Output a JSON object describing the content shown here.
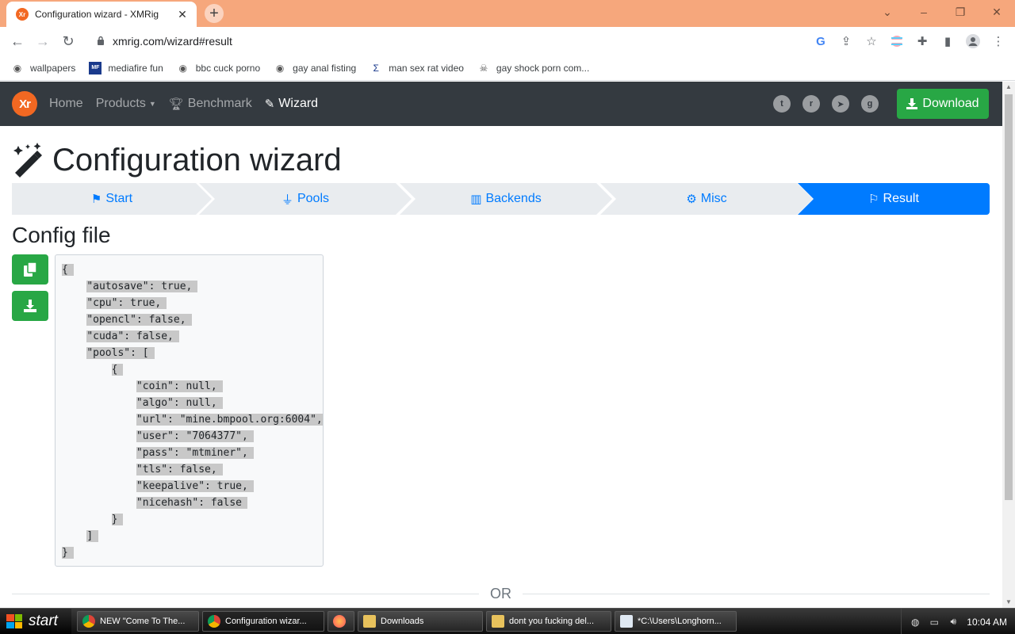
{
  "browser": {
    "tab_title": "Configuration wizard - XMRig",
    "favicon_text": "Xr",
    "url": "xmrig.com/wizard#result",
    "bookmarks": [
      {
        "label": "wallpapers"
      },
      {
        "label": "mediafire fun"
      },
      {
        "label": "bbc cuck porno"
      },
      {
        "label": "gay anal fisting"
      },
      {
        "label": "man sex rat video"
      },
      {
        "label": "gay shock porn com..."
      }
    ]
  },
  "navbar": {
    "brand": "Xr",
    "links": [
      "Home",
      "Products",
      "Benchmark",
      "Wizard"
    ],
    "download_label": "Download"
  },
  "page": {
    "title": "Configuration wizard",
    "steps": [
      "Start",
      "Pools",
      "Backends",
      "Misc",
      "Result"
    ],
    "active_step": "Result",
    "config_title": "Config file",
    "or_label": "OR"
  },
  "config_lines": [
    "{",
    "    \"autosave\": true,",
    "    \"cpu\": true,",
    "    \"opencl\": false,",
    "    \"cuda\": false,",
    "    \"pools\": [",
    "        {",
    "            \"coin\": null,",
    "            \"algo\": null,",
    "            \"url\": \"mine.bmpool.org:6004\",",
    "            \"user\": \"7064377\",",
    "            \"pass\": \"mtminer\",",
    "            \"tls\": false,",
    "            \"keepalive\": true,",
    "            \"nicehash\": false",
    "        }",
    "    ]",
    "}"
  ],
  "taskbar": {
    "start_label": "start",
    "items": [
      {
        "label": "NEW \"Come To The..."
      },
      {
        "label": "Configuration wizar..."
      },
      {
        "label": ""
      },
      {
        "label": "Downloads"
      },
      {
        "label": "dont you fucking del..."
      },
      {
        "label": "*C:\\Users\\Longhorn..."
      }
    ],
    "clock": "10:04 AM"
  },
  "colors": {
    "accent": "#007bff",
    "success": "#28a745",
    "navbar": "#343a40",
    "brand": "#f26822",
    "tabstrip": "#f6a77c"
  }
}
